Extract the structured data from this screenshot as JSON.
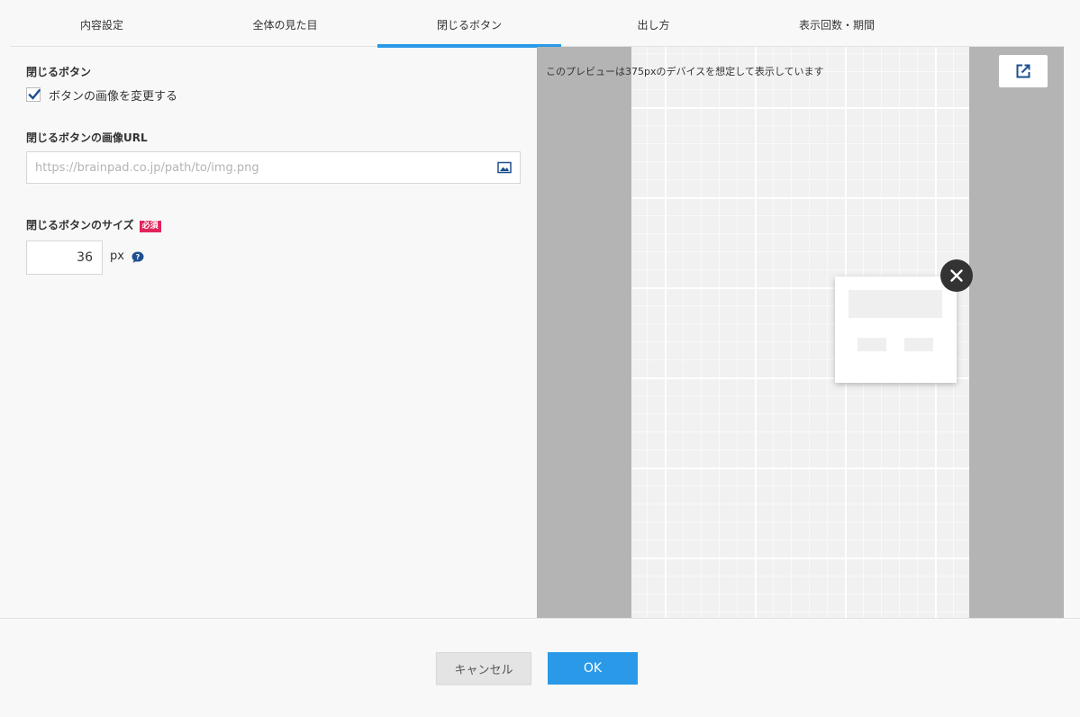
{
  "tabs": [
    {
      "label": "内容設定"
    },
    {
      "label": "全体の見た目"
    },
    {
      "label": "閉じるボタン"
    },
    {
      "label": "出し方"
    },
    {
      "label": "表示回数・期間"
    }
  ],
  "active_tab_color": "#2a9ae8",
  "form": {
    "close_button_heading": "閉じるボタン",
    "change_image_checkbox_label": "ボタンの画像を変更する",
    "change_image_checked": true,
    "image_url_heading": "閉じるボタンの画像URL",
    "image_url_placeholder": "https://brainpad.co.jp/path/to/img.png",
    "image_url_value": "",
    "size_heading": "閉じるボタンのサイズ",
    "required_badge": "必須",
    "required_badge_color": "#e2245c",
    "size_value": "36",
    "size_unit": "px"
  },
  "preview": {
    "note": "このプレビューは375pxのデバイスを想定して表示しています"
  },
  "footer": {
    "cancel_label": "キャンセル",
    "ok_label": "OK"
  },
  "icons": {
    "image_picker": "image-icon",
    "help": "help-bubble-icon",
    "close": "close-icon",
    "external_link": "external-link-icon",
    "checkbox_check": "check-icon"
  }
}
